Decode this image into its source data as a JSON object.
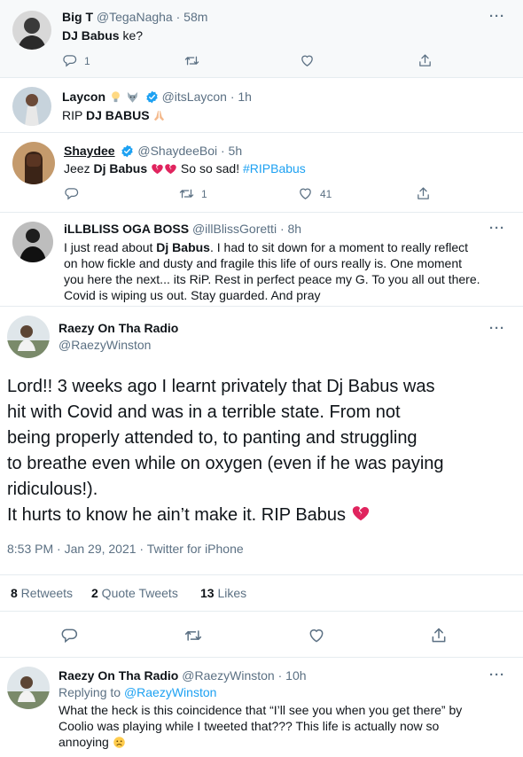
{
  "tweets": [
    {
      "name": "Big T",
      "handle": "@TegaNagha",
      "sep": "·",
      "time": "58m",
      "text_pre": "",
      "text_bold": "DJ Babus",
      "text_post": " ke?",
      "reply_count": "1",
      "retweet_count": "",
      "like_count": ""
    },
    {
      "name": "Laycon",
      "handle": "@itsLaycon",
      "sep": "·",
      "time": "1h",
      "text_pre": "RIP ",
      "text_bold": "DJ BABUS",
      "text_post": ""
    },
    {
      "name": "Shaydee",
      "handle": "@ShaydeeBoi",
      "sep": "·",
      "time": "5h",
      "text_pre": "Jeez ",
      "text_bold": "Dj Babus",
      "text_mid": " So so sad! ",
      "hashtag": "#RIPBabus",
      "reply_count": "",
      "retweet_count": "1",
      "like_count": "41"
    },
    {
      "name": "iLLBLISS OGA BOSS",
      "handle": "@illBlissGoretti",
      "sep": "·",
      "time": "8h",
      "line1_pre": "I just read about ",
      "line1_bold": "Dj Babus",
      "line1_post": ". I had to sit down for a moment to really reflect",
      "line2": "on how fickle and dusty and fragile this life of ours really is. One moment",
      "line3": "you here the next... its RiP. Rest in perfect peace my G. To you all out there.",
      "line4": "Covid is wiping us out. Stay guarded. And pray"
    }
  ],
  "main_tweet": {
    "name": "Raezy On Tha Radio",
    "handle": "@RaezyWinston",
    "line1": "Lord!! 3 weeks ago I learnt privately that Dj Babus was",
    "line2": "hit with Covid and was in a terrible state. From not",
    "line3": "being properly attended to, to panting and struggling",
    "line4": "to breathe even while on oxygen (even if he was paying",
    "line5": "ridiculous!).",
    "line6": "It hurts to know he ain’t make it. RIP Babus",
    "meta": "8:53 PM · Jan 29, 2021 · Twitter for iPhone",
    "retweets_n": "8",
    "retweets_label": " Retweets",
    "quotes_n": "2",
    "quotes_label": " Quote Tweets",
    "likes_n": "13",
    "likes_label": " Likes"
  },
  "reply_tweet": {
    "name": "Raezy On Tha Radio",
    "handle": "@RaezyWinston",
    "sep": "·",
    "time": "10h",
    "replying_to_label": "Replying to ",
    "replying_to_handle": "@RaezyWinston",
    "line1": "What the heck is this coincidence that “I’ll see you when you get there” by",
    "line2": "Coolio was playing while I tweeted that??? This life is actually now so",
    "line3": "annoying"
  },
  "more_label": "···",
  "colors": {
    "accent": "#1da1f2",
    "muted": "#5b7083",
    "border": "#e6ecf0",
    "broken_heart": "#e0245e"
  },
  "icons": [
    "reply-icon",
    "retweet-icon",
    "like-icon",
    "share-icon",
    "verified-badge-icon",
    "more-icon",
    "broken-heart-emoji",
    "pray-emoji",
    "sad-face-emoji",
    "lightbulb-emoji",
    "wolf-emoji"
  ]
}
